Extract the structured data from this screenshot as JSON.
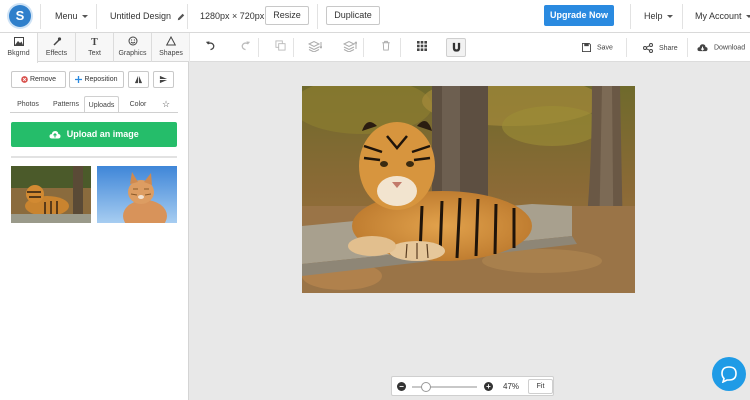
{
  "topbar": {
    "logo_letter": "S",
    "menu_label": "Menu",
    "design_title": "Untitled Design",
    "dimensions": "1280px × 720px",
    "resize_label": "Resize",
    "duplicate_label": "Duplicate",
    "upgrade_label": "Upgrade Now",
    "help_label": "Help",
    "account_label": "My Account"
  },
  "left_panel": {
    "categories": [
      {
        "label": "Bkgrnd",
        "icon": "image-icon"
      },
      {
        "label": "Effects",
        "icon": "magic-wand-icon"
      },
      {
        "label": "Text",
        "icon": "text-icon"
      },
      {
        "label": "Graphics",
        "icon": "smiley-icon"
      },
      {
        "label": "Shapes",
        "icon": "triangle-icon"
      }
    ],
    "remove_label": "Remove",
    "reposition_label": "Reposition",
    "sub_tabs": [
      "Photos",
      "Patterns",
      "Uploads",
      "Color"
    ],
    "upload_label": "Upload an image",
    "uploads": [
      {
        "subject": "tiger"
      },
      {
        "subject": "cat"
      }
    ]
  },
  "toolbar": {
    "save_label": "Save",
    "share_label": "Share",
    "download_label": "Download"
  },
  "zoom": {
    "percent": "47%",
    "fit_label": "Fit",
    "level": 0.47
  },
  "colors": {
    "accent_blue": "#2a8ae0",
    "upload_green": "#25bd6a",
    "chat_blue": "#1f9be6"
  }
}
